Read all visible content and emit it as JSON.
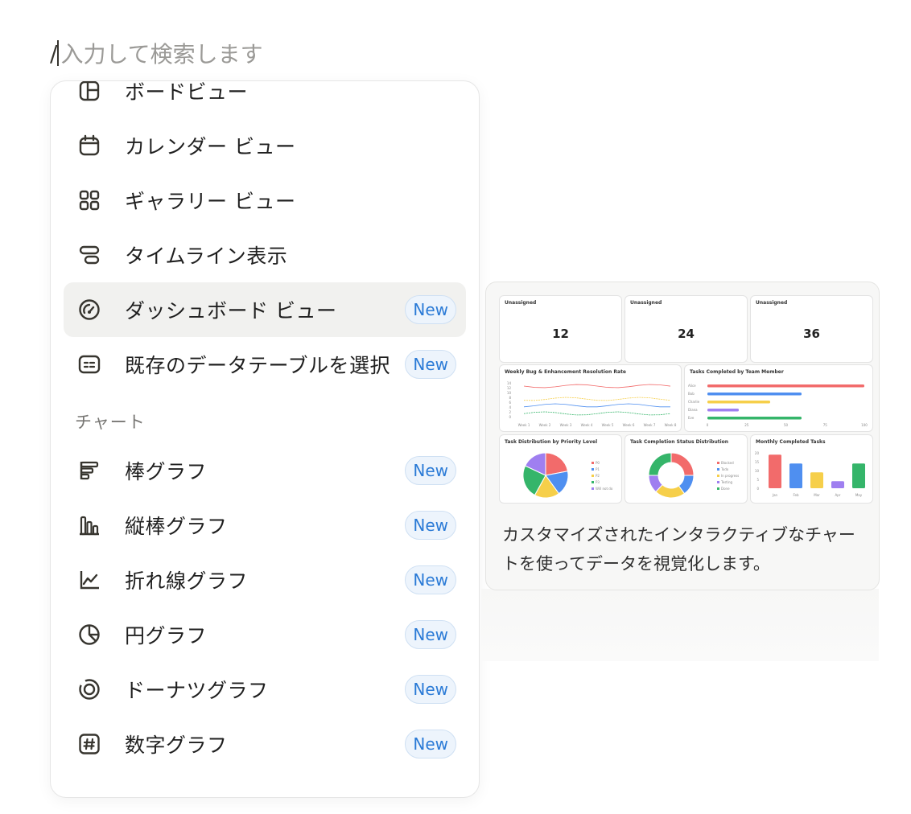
{
  "search": {
    "slash": "/",
    "placeholder": "入力して検索します"
  },
  "menu": {
    "items": [
      {
        "label": "ボードビュー",
        "icon": "board-icon",
        "badge": ""
      },
      {
        "label": "カレンダー ビュー",
        "icon": "calendar-icon",
        "badge": ""
      },
      {
        "label": "ギャラリー ビュー",
        "icon": "gallery-icon",
        "badge": ""
      },
      {
        "label": "タイムライン表示",
        "icon": "timeline-icon",
        "badge": ""
      },
      {
        "label": "ダッシュボード ビュー",
        "icon": "dashboard-icon",
        "badge": "New"
      },
      {
        "label": "既存のデータテーブルを選択",
        "icon": "data-table-icon",
        "badge": "New"
      }
    ],
    "section_label": "チャート",
    "chart_items": [
      {
        "label": "棒グラフ",
        "icon": "bar-chart-icon",
        "badge": "New"
      },
      {
        "label": "縦棒グラフ",
        "icon": "column-chart-icon",
        "badge": "New"
      },
      {
        "label": "折れ線グラフ",
        "icon": "line-chart-icon",
        "badge": "New"
      },
      {
        "label": "円グラフ",
        "icon": "pie-chart-icon",
        "badge": "New"
      },
      {
        "label": "ドーナツグラフ",
        "icon": "donut-chart-icon",
        "badge": "New"
      },
      {
        "label": "数字グラフ",
        "icon": "number-chart-icon",
        "badge": "New"
      }
    ]
  },
  "preview": {
    "description": "カスタマイズされたインタラクティブなチャートを使ってデータを視覚化します。",
    "kpis": [
      {
        "title": "Unassigned",
        "value": "12"
      },
      {
        "title": "Unassigned",
        "value": "24"
      },
      {
        "title": "Unassigned",
        "value": "36"
      }
    ],
    "line_chart": {
      "title": "Weekly Bug & Enhancement Resolution Rate",
      "y_ticks": [
        "14",
        "12",
        "10",
        "8",
        "6",
        "4",
        "2",
        "0"
      ],
      "x_ticks": [
        "Week 1",
        "Week 2",
        "Week 3",
        "Week 4",
        "Week 5",
        "Week 6",
        "Week 7",
        "Week 8"
      ]
    },
    "bar_chart": {
      "title": "Tasks Completed by Team Member",
      "categories": [
        "Alice",
        "Bob",
        "Charlie",
        "Diana",
        "Eve"
      ],
      "values": [
        100,
        60,
        40,
        20,
        60
      ],
      "x_ticks": [
        "0",
        "25",
        "50",
        "75",
        "100"
      ],
      "colors": [
        "#f26b6b",
        "#4f8ff0",
        "#f6cf4a",
        "#9f7ff0",
        "#35b56a"
      ]
    },
    "pie_chart": {
      "title": "Task Distribution by Priority Level",
      "legend": [
        "P0",
        "P1",
        "P2",
        "P3",
        "Will not do"
      ],
      "values": [
        22,
        18,
        18,
        24,
        18
      ],
      "colors": [
        "#f26b6b",
        "#4f8ff0",
        "#f6cf4a",
        "#35b56a",
        "#9f7ff0"
      ]
    },
    "donut_chart": {
      "title": "Task Completion Status Distribution",
      "legend": [
        "Blocked",
        "Todo",
        "In progress",
        "Testing",
        "Done"
      ],
      "values": [
        25,
        15,
        22,
        13,
        25
      ],
      "colors": [
        "#f26b6b",
        "#4f8ff0",
        "#f6cf4a",
        "#9f7ff0",
        "#35b56a"
      ]
    },
    "column_chart": {
      "title": "Monthly Completed Tasks",
      "categories": [
        "Jan",
        "Feb",
        "Mar",
        "Apr",
        "May"
      ],
      "values": [
        19,
        14,
        9,
        4,
        14
      ],
      "y_ticks": [
        "20",
        "15",
        "10",
        "5",
        "0"
      ],
      "colors": [
        "#f26b6b",
        "#4f8ff0",
        "#f6cf4a",
        "#9f7ff0",
        "#35b56a"
      ]
    }
  }
}
